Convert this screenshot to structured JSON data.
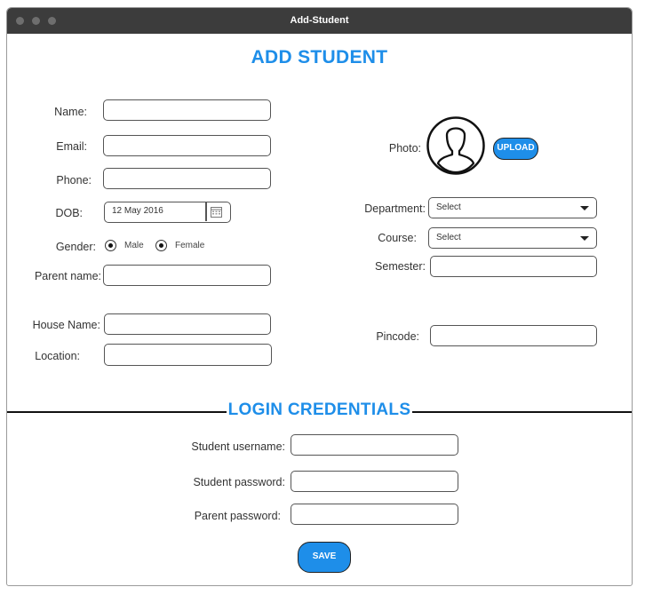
{
  "window": {
    "title": "Add-Student"
  },
  "form": {
    "heading": "ADD STUDENT",
    "labels": {
      "name": "Name:",
      "email": "Email:",
      "phone": "Phone:",
      "dob": "DOB:",
      "gender": "Gender:",
      "parent_name": "Parent name:",
      "house_name": "House Name:",
      "location": "Location:",
      "photo": "Photo:",
      "department": "Department:",
      "course": "Course:",
      "semester": "Semester:",
      "pincode": "Pincode:"
    },
    "dob_value": "12 May 2016",
    "gender_options": [
      "Male",
      "Female"
    ],
    "department_selected": "Select",
    "course_selected": "Select",
    "upload_label": "UPLOAD"
  },
  "login": {
    "heading": "LOGIN CREDENTIALS",
    "labels": {
      "student_username": "Student username:",
      "student_password": "Student password:",
      "parent_password": "Parent password:"
    },
    "save_label": "SAVE"
  },
  "colors": {
    "accent": "#1e8ee9",
    "titlebar": "#3c3c3c"
  }
}
